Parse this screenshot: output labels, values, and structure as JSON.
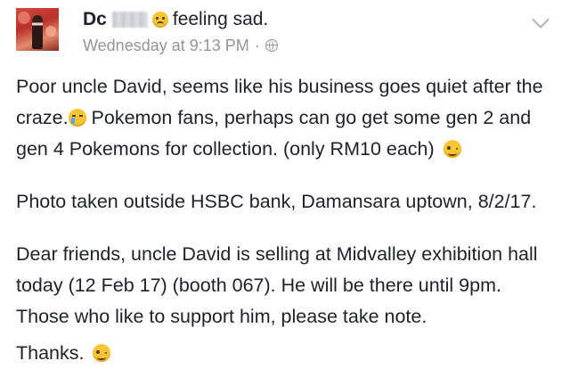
{
  "post": {
    "author": "Dc",
    "activity": "feeling sad.",
    "timestamp": "Wednesday at 9:13 PM",
    "separator": "·",
    "paragraph1": {
      "part1": "Poor uncle David,  seems like his business goes quiet after the craze.",
      "part2": "  Pokemon fans,  perhaps can go get some gen 2 and gen 4 Pokemons for collection. (only RM10 each)"
    },
    "paragraph2": "Photo taken outside HSBC bank,   Damansara uptown, 8/2/17.",
    "paragraph3": "Dear friends,  uncle David is selling at Midvalley exhibition hall today  (12 Feb 17)  (booth 067). He will be there until 9pm.  Those who like to support him,  please take note.",
    "closing": "Thanks."
  },
  "icons": {
    "activity_emoji": "sad-face-icon",
    "privacy": "globe-icon",
    "menu": "chevron-down-icon",
    "emoji_1": "crying-face-icon",
    "emoji_2": "winking-face-icon",
    "emoji_3": "winking-face-icon"
  }
}
